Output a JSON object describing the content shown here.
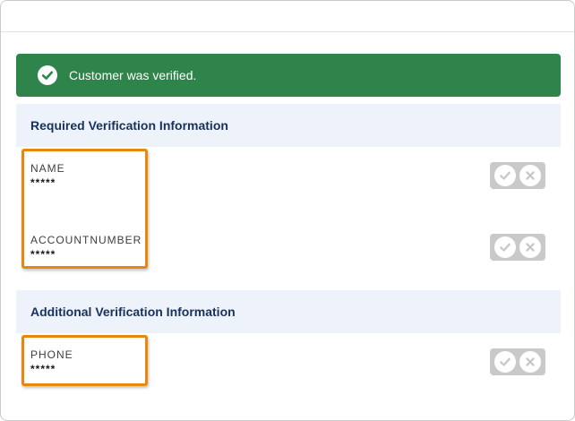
{
  "toast": {
    "message": "Customer was verified.",
    "icon": "success-check-icon",
    "color": "#2e844a"
  },
  "required_section": {
    "title": "Required Verification Information",
    "fields": [
      {
        "label": "NAME",
        "value": "*****"
      },
      {
        "label": "ACCOUNTNUMBER",
        "value": "*****"
      }
    ]
  },
  "additional_section": {
    "title": "Additional Verification Information",
    "fields": [
      {
        "label": "PHONE",
        "value": "*****"
      }
    ]
  },
  "verify_controls": {
    "confirm_icon": "check-icon",
    "reject_icon": "close-icon"
  },
  "highlight_color": "#e8870e"
}
